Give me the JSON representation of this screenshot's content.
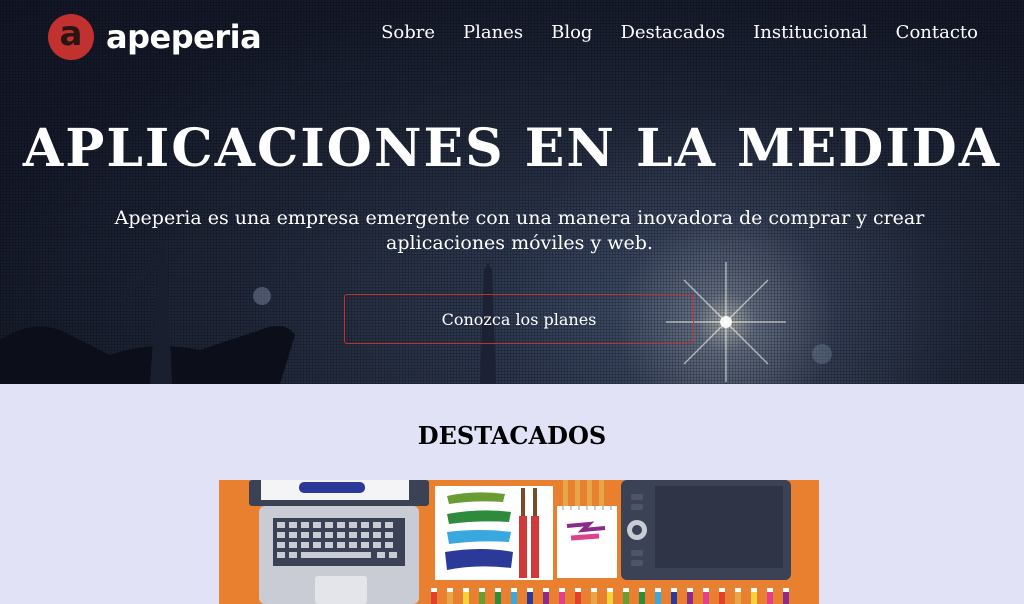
{
  "brand": {
    "name": "apeperia",
    "logo_letter": "a",
    "accent_color": "#c03130"
  },
  "nav": {
    "items": [
      {
        "label": "Sobre"
      },
      {
        "label": "Planes"
      },
      {
        "label": "Blog"
      },
      {
        "label": "Destacados"
      },
      {
        "label": "Institucional"
      },
      {
        "label": "Contacto"
      }
    ]
  },
  "hero": {
    "title": "APLICACIONES EN LA MEDIDA",
    "subtitle": "Apeperia es una empresa emergente con una manera inovadora de comprar y crear aplicaciones móviles y web.",
    "cta_label": "Conozca los planes"
  },
  "featured": {
    "title": "DESTACADOS",
    "image_background": "#e8802f"
  }
}
